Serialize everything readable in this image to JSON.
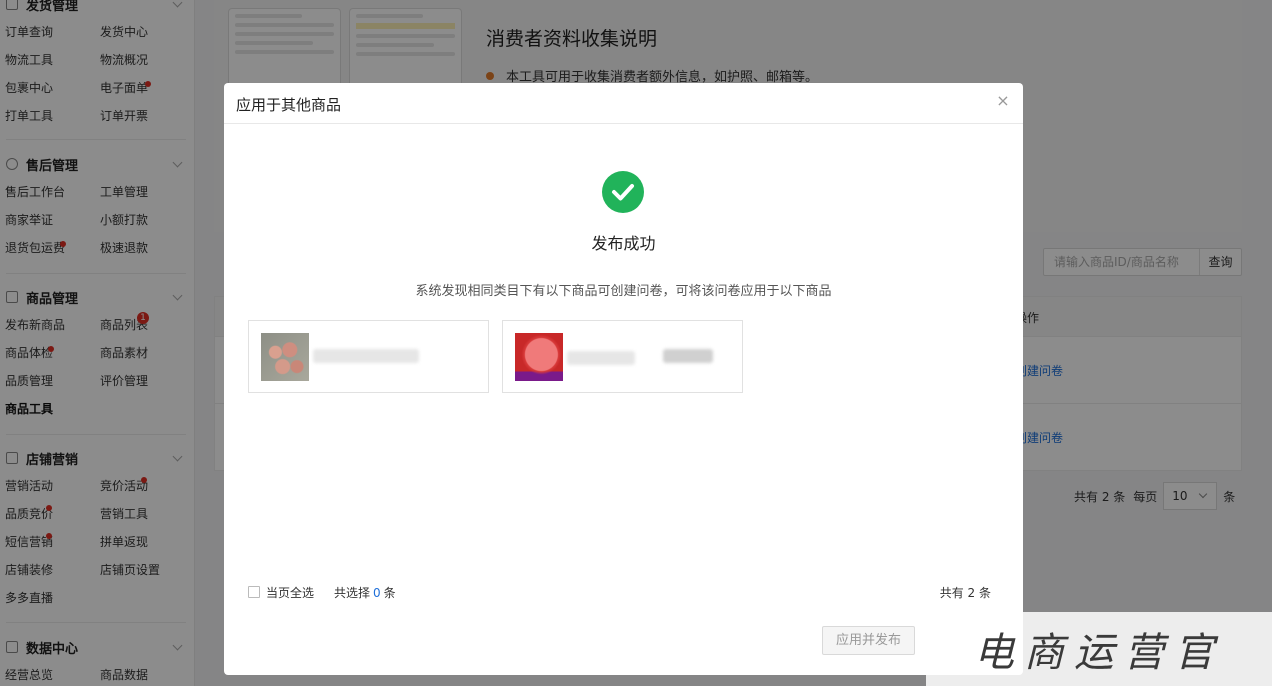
{
  "sidebar": {
    "sections": [
      {
        "title": "发货管理",
        "icon": "doc-icon",
        "items": [
          "订单查询",
          "发货中心",
          "物流工具",
          "物流概况",
          "包裹中心",
          "电子面单",
          "打单工具",
          "订单开票"
        ]
      },
      {
        "title": "售后管理",
        "icon": "shield-icon",
        "items": [
          "售后工作台",
          "工单管理",
          "商家举证",
          "小额打款",
          "退货包运费",
          "极速退款"
        ]
      },
      {
        "title": "商品管理",
        "icon": "box-icon",
        "items": [
          "发布新商品",
          "商品列表",
          "商品体检",
          "商品素材",
          "品质管理",
          "评价管理",
          "商品工具"
        ],
        "badge": "1"
      },
      {
        "title": "店铺营销",
        "icon": "store-icon",
        "items": [
          "营销活动",
          "竞价活动",
          "品质竞价",
          "营销工具",
          "短信营销",
          "拼单返现",
          "店铺装修",
          "店铺页设置",
          "多多直播"
        ]
      },
      {
        "title": "数据中心",
        "icon": "chart-icon",
        "items": [
          "经营总览",
          "商品数据"
        ]
      }
    ]
  },
  "background": {
    "intro_title": "消费者资料收集说明",
    "intro_bullet": "本工具可用于收集消费者额外信息，如护照、邮箱等。",
    "search_placeholder": "请输入商品ID/商品名称",
    "search_button": "查询",
    "table_header_action": "操作",
    "row_action": "创建问卷",
    "pager_total": "共有 2 条",
    "pager_per_page": "每页",
    "pager_size": "10",
    "pager_unit": "条"
  },
  "modal": {
    "title": "应用于其他商品",
    "close": "×",
    "success_text": "发布成功",
    "hint": "系统发现相同类目下有以下商品可创建问卷，可将该问卷应用于以下商品",
    "select_all": "当页全选",
    "selected_prefix": "共选择",
    "selected_count": "0",
    "selected_suffix": "条",
    "total": "共有 2 条",
    "publish_button": "应用并发布"
  },
  "watermark": "电商运营官",
  "colors": {
    "success": "#21b35a",
    "link": "#1e6fd9",
    "badge": "#e02e24",
    "bullet": "#e07b2a"
  }
}
